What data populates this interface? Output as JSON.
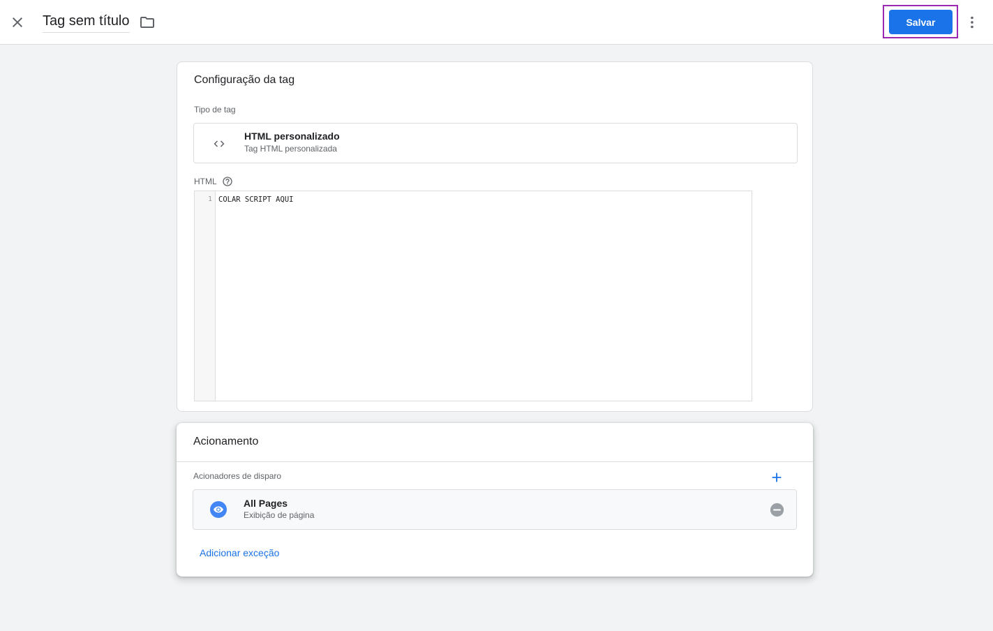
{
  "header": {
    "title": "Tag sem título",
    "save_label": "Salvar",
    "close_icon": "close-icon",
    "folder_icon": "folder-icon",
    "more_icon": "more-vert-icon"
  },
  "tag_config": {
    "title": "Configuração da tag",
    "tag_type_label": "Tipo de tag",
    "tag_type": {
      "icon": "code-icon",
      "name": "HTML personalizado",
      "description": "Tag HTML personalizada"
    },
    "html_label": "HTML",
    "help_icon": "help-icon",
    "editor": {
      "line_number": "1",
      "code": "COLAR SCRIPT AQUI"
    }
  },
  "triggering": {
    "title": "Acionamento",
    "firing_triggers_label": "Acionadores de disparo",
    "add_icon": "plus-icon",
    "trigger": {
      "icon": "eye-icon",
      "name": "All Pages",
      "description": "Exibição de página",
      "remove_icon": "remove-circle-icon"
    },
    "add_exception_label": "Adicionar exceção"
  },
  "colors": {
    "primary": "#1a73e8",
    "highlight": "#9c27b0",
    "background": "#f1f3f4"
  }
}
